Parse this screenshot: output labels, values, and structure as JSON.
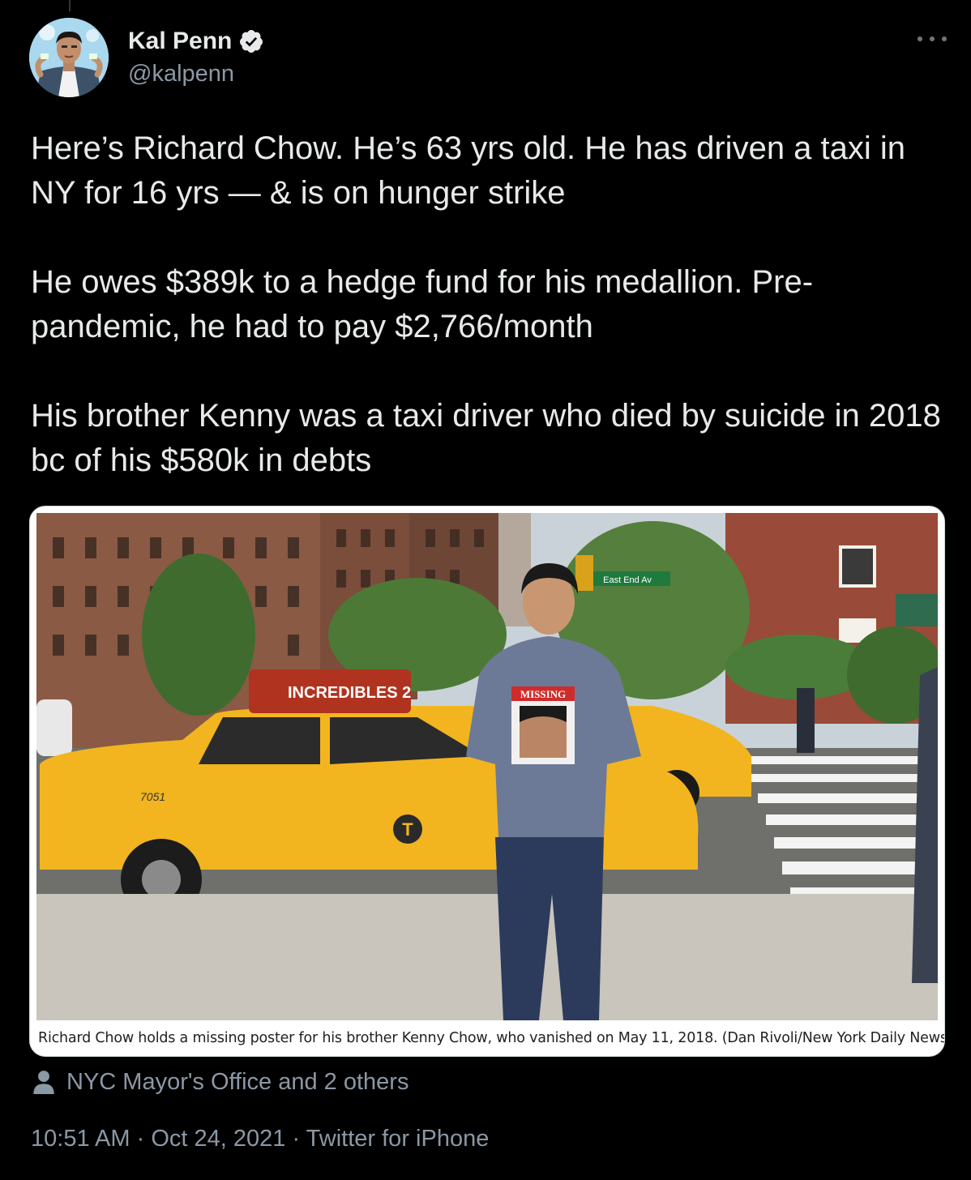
{
  "author": {
    "display_name": "Kal Penn",
    "handle": "@kalpenn",
    "verified": true
  },
  "tweet": {
    "paragraphs": [
      "Here’s Richard Chow. He’s 63 yrs old. He has driven a taxi in NY for 16 yrs — & is on hunger strike",
      "He owes $389k to a hedge fund for his medallion. Pre-pandemic, he had to pay $2,766/month",
      "His brother Kenny was a taxi driver who died by suicide in 2018 bc of his $580k in debts"
    ]
  },
  "media": {
    "sign_text": "East End Av",
    "taxi_topper": "INCREDIBLES 2",
    "taxi_number": "7051",
    "poster_label": "MISSING",
    "caption": "Richard Chow holds a missing poster for his brother Kenny Chow, who vanished on May 11, 2018. (Dan Rivoli/New York Daily News)"
  },
  "tags": {
    "text": "NYC Mayor's Office and 2 others"
  },
  "meta": {
    "time": "10:51 AM",
    "separator": "·",
    "date": "Oct 24, 2021",
    "source": "Twitter for iPhone"
  },
  "colors": {
    "background": "#000000",
    "text_primary": "#e7e9ea",
    "text_secondary": "#8b98a5",
    "verified": "#e7e9ea",
    "taxi_yellow": "#f2b51f"
  },
  "icons": {
    "verified": "verified-badge-icon",
    "more": "more-options-icon",
    "tagged": "person-icon"
  }
}
